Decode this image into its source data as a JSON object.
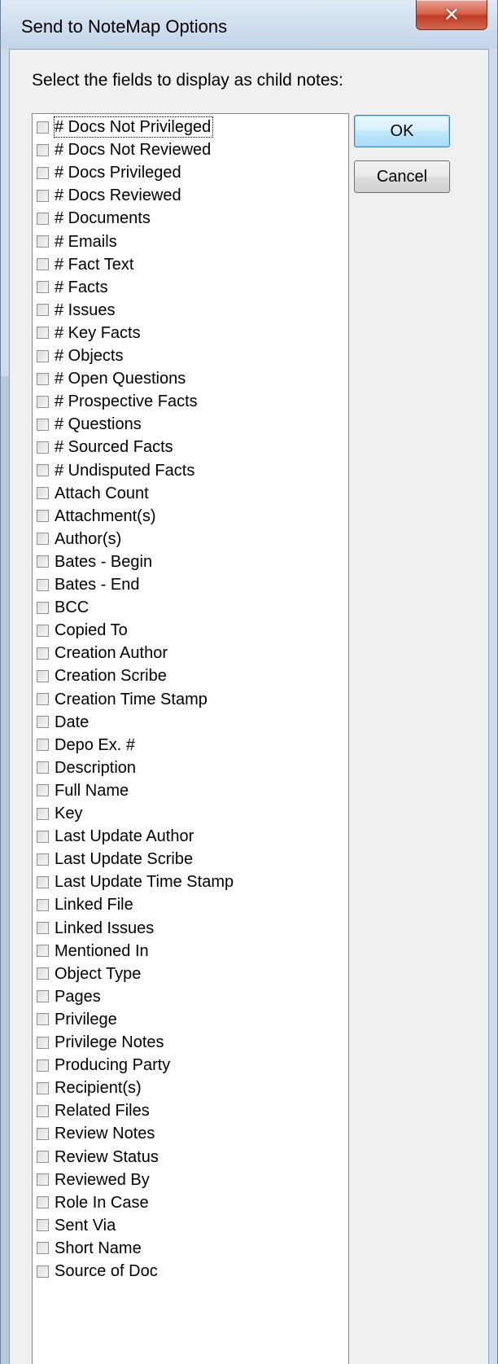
{
  "window": {
    "title": "Send to NoteMap Options",
    "close_glyph": "✕"
  },
  "dialog": {
    "instruction": "Select the fields to display as child notes:",
    "ok_label": "OK",
    "cancel_label": "Cancel"
  },
  "fields": [
    "# Docs Not Privileged",
    "# Docs Not Reviewed",
    "# Docs Privileged",
    "# Docs Reviewed",
    "# Documents",
    "# Emails",
    "# Fact Text",
    "# Facts",
    "# Issues",
    "# Key Facts",
    "# Objects",
    "# Open Questions",
    "# Prospective Facts",
    "# Questions",
    "# Sourced Facts",
    "# Undisputed Facts",
    "Attach Count",
    "Attachment(s)",
    "Author(s)",
    "Bates - Begin",
    "Bates - End",
    "BCC",
    "Copied To",
    "Creation Author",
    "Creation Scribe",
    "Creation Time Stamp",
    "Date",
    "Depo Ex. #",
    "Description",
    "Full Name",
    "Key",
    "Last Update Author",
    "Last Update Scribe",
    "Last Update Time Stamp",
    "Linked File",
    "Linked Issues",
    "Mentioned In",
    "Object Type",
    "Pages",
    "Privilege",
    "Privilege Notes",
    "Producing Party",
    "Recipient(s)",
    "Related Files",
    "Review Notes",
    "Review Status",
    "Reviewed By",
    "Role In Case",
    "Sent Via",
    "Short Name",
    "Source of Doc"
  ],
  "checked": [],
  "focused_index": 0,
  "colors": {
    "titlebar": "#cddcee",
    "close_button": "#c13b22",
    "dialog_bg": "#f0f0f0",
    "default_button_border": "#3c7fb1"
  }
}
